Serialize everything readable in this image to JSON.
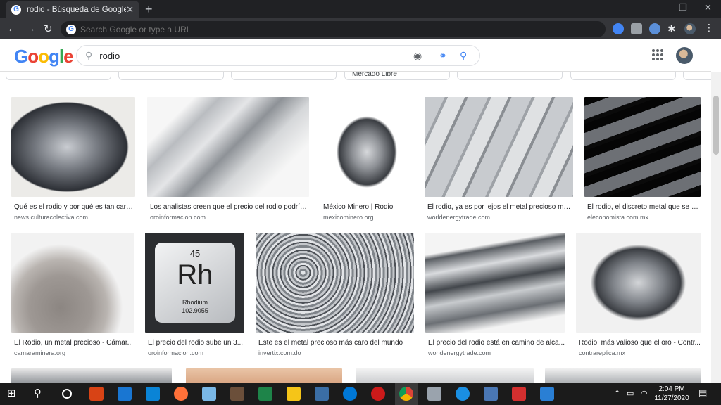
{
  "browser": {
    "tab_title": "rodio - Búsqueda de Google",
    "tab_close": "✕",
    "new_tab": "+",
    "omnibox_placeholder": "Search Google or type a URL"
  },
  "google": {
    "logo": "Google",
    "query": "rodio"
  },
  "chips": [
    "Mercado Libre"
  ],
  "results": [
    {
      "caption": "Qué es el rodio y por qué es tan caro...",
      "source": "news.culturacolectiva.com"
    },
    {
      "caption": "Los analistas creen que el precio del rodio podría...",
      "source": "oroinformacion.com"
    },
    {
      "caption": "México Minero | Rodio",
      "source": "mexicominero.org"
    },
    {
      "caption": "El rodio, ya es por lejos el metal precioso má...",
      "source": "worldenergytrade.com"
    },
    {
      "caption": "El rodio, el discreto metal que se h...",
      "source": "eleconomista.com.mx"
    },
    {
      "caption": "El Rodio, un metal precioso - Cámar...",
      "source": "camaraminera.org"
    },
    {
      "caption": "El precio del rodio sube un 3...",
      "source": "oroinformacion.com"
    },
    {
      "caption": "Este es el metal precioso más caro del mundo",
      "source": "invertix.com.do"
    },
    {
      "caption": "El precio del rodio está en camino de alca...",
      "source": "worldenergytrade.com"
    },
    {
      "caption": "Rodio, más valioso que el oro - Contr...",
      "source": "contrareplica.mx"
    }
  ],
  "tile": {
    "number": "45",
    "symbol": "Rh",
    "name": "Rhodium",
    "mass": "102.9055"
  },
  "taskbar": {
    "time": "2:04 PM",
    "date": "11/27/2020"
  }
}
